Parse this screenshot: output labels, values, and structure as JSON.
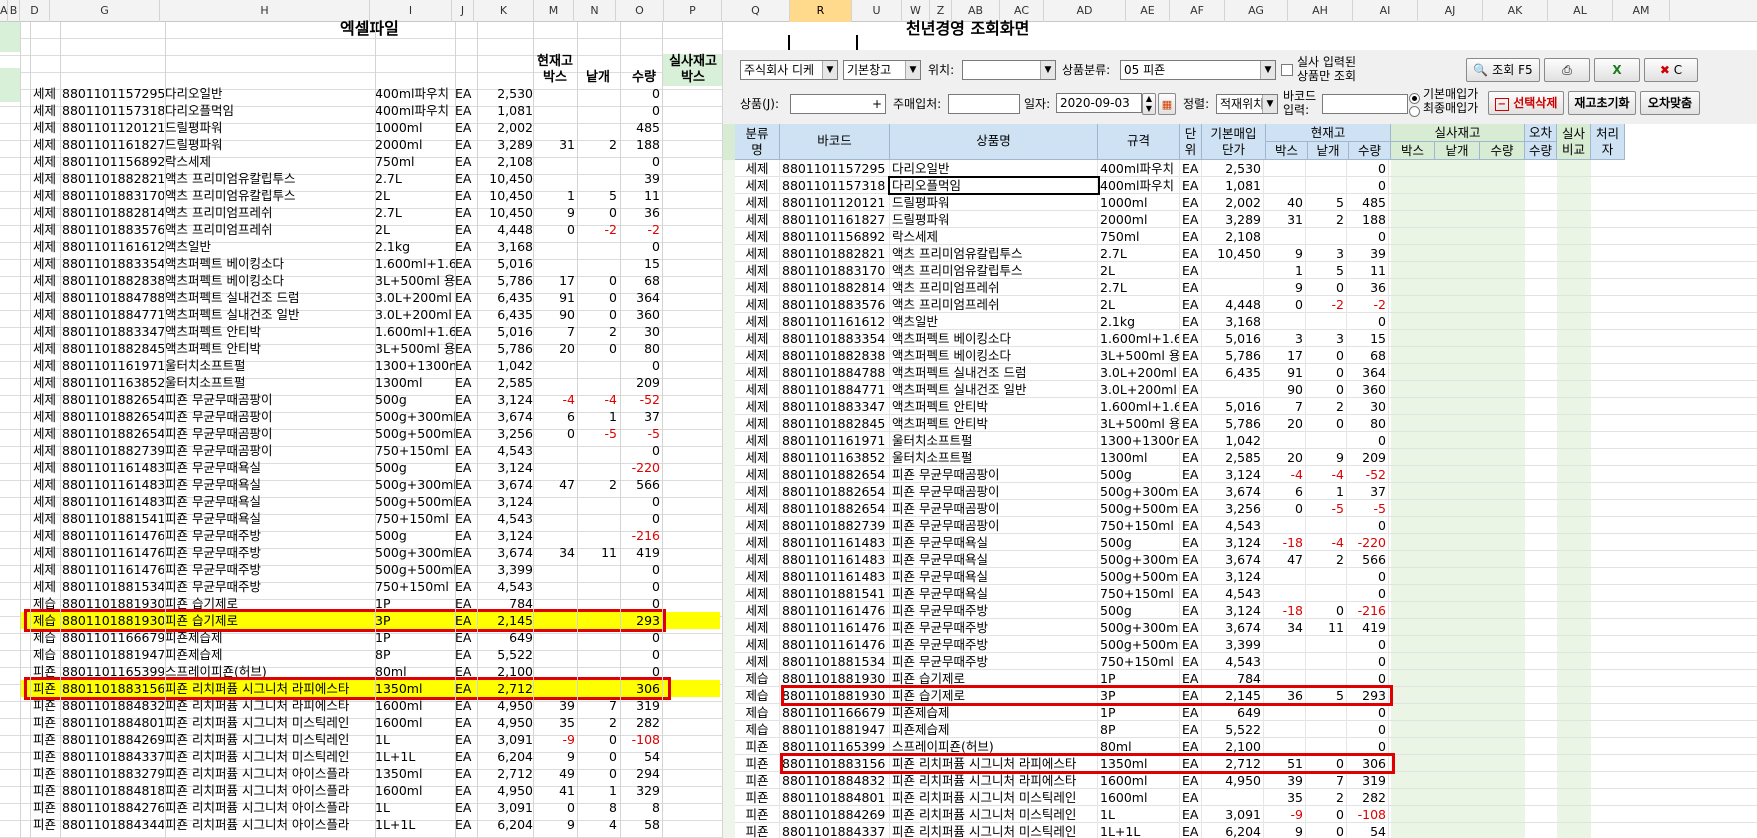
{
  "columns": [
    {
      "label": "A",
      "w": 8
    },
    {
      "label": "B",
      "w": 12
    },
    {
      "label": "D",
      "w": 30
    },
    {
      "label": "G",
      "w": 110
    },
    {
      "label": "H",
      "w": 210
    },
    {
      "label": "I",
      "w": 82
    },
    {
      "label": "J",
      "w": 22
    },
    {
      "label": "K",
      "w": 60
    },
    {
      "label": "M",
      "w": 40
    },
    {
      "label": "N",
      "w": 42
    },
    {
      "label": "O",
      "w": 48
    },
    {
      "label": "P",
      "w": 58
    },
    {
      "label": "Q",
      "w": 68
    },
    {
      "label": "R",
      "w": 62,
      "selected": true
    },
    {
      "label": "U",
      "w": 50
    },
    {
      "label": "W",
      "w": 28
    },
    {
      "label": "Z",
      "w": 22
    },
    {
      "label": "AB",
      "w": 48
    },
    {
      "label": "AC",
      "w": 44
    },
    {
      "label": "AD",
      "w": 82
    },
    {
      "label": "AE",
      "w": 44
    },
    {
      "label": "AF",
      "w": 55
    },
    {
      "label": "AG",
      "w": 63
    },
    {
      "label": "AH",
      "w": 65
    },
    {
      "label": "AI",
      "w": 65
    },
    {
      "label": "AJ",
      "w": 65
    },
    {
      "label": "AK",
      "w": 65
    },
    {
      "label": "AL",
      "w": 65
    },
    {
      "label": "AM",
      "w": 57
    }
  ],
  "left": {
    "title": "엑셀파일",
    "header_current": "현재고",
    "header_box": "박스",
    "header_each": "낱개",
    "header_qty": "수량",
    "header_actual": "실사재고",
    "header_actual_box": "박스",
    "rows": [
      [
        "세제",
        "8801101157295",
        "다리오일반",
        "400ml파우치",
        "EA",
        "2,530",
        "",
        "",
        "0"
      ],
      [
        "세제",
        "8801101157318",
        "다리오플먹임",
        "400ml파우치",
        "EA",
        "1,081",
        "",
        "",
        "0"
      ],
      [
        "세제",
        "8801101120121",
        "드릴평파워",
        "1000ml",
        "EA",
        "2,002",
        "",
        "",
        "485"
      ],
      [
        "세제",
        "8801101161827",
        "드릴평파워",
        "2000ml",
        "EA",
        "3,289",
        "31",
        "2",
        "188"
      ],
      [
        "세제",
        "8801101156892",
        "락스세제",
        "750ml",
        "EA",
        "2,108",
        "",
        "",
        "0"
      ],
      [
        "세제",
        "8801101882821",
        "액츠 프리미엄유칼립투스",
        "2.7L",
        "EA",
        "10,450",
        "",
        "",
        "39"
      ],
      [
        "세제",
        "8801101883170",
        "액츠 프리미엄유칼립투스",
        "2L",
        "EA",
        "10,450",
        "1",
        "5",
        "11"
      ],
      [
        "세제",
        "8801101882814",
        "액츠 프리미엄프레쉬",
        "2.7L",
        "EA",
        "10,450",
        "9",
        "0",
        "36"
      ],
      [
        "세제",
        "8801101883576",
        "액츠 프리미엄프레쉬",
        "2L",
        "EA",
        "4,448",
        "0",
        "-2",
        "-2"
      ],
      [
        "세제",
        "8801101161612",
        "액츠일반",
        "2.1kg",
        "EA",
        "3,168",
        "",
        "",
        "0"
      ],
      [
        "세제",
        "8801101883354",
        "액츠퍼펙트 베이킹소다",
        "1.600ml+1.60",
        "EA",
        "5,016",
        "",
        "",
        "15"
      ],
      [
        "세제",
        "8801101882838",
        "액츠퍼펙트 베이킹소다",
        "3L+500ml 용기",
        "EA",
        "5,786",
        "17",
        "0",
        "68"
      ],
      [
        "세제",
        "8801101884788",
        "액츠퍼펙트 실내건조 드럼",
        "3.0L+200ml",
        "EA",
        "6,435",
        "91",
        "0",
        "364"
      ],
      [
        "세제",
        "8801101884771",
        "액츠퍼펙트 실내건조 일반",
        "3.0L+200ml",
        "EA",
        "6,435",
        "90",
        "0",
        "360"
      ],
      [
        "세제",
        "8801101883347",
        "액츠퍼펙트 안티박",
        "1.600ml+1.60",
        "EA",
        "5,016",
        "7",
        "2",
        "30"
      ],
      [
        "세제",
        "8801101882845",
        "액츠퍼펙트 안티박",
        "3L+500ml 용기",
        "EA",
        "5,786",
        "20",
        "0",
        "80"
      ],
      [
        "세제",
        "8801101161971",
        "울터치소프트펄",
        "1300+1300ml",
        "EA",
        "1,042",
        "",
        "",
        "0"
      ],
      [
        "세제",
        "8801101163852",
        "울터치소프트펄",
        "1300ml",
        "EA",
        "2,585",
        "",
        "",
        "209"
      ],
      [
        "세제",
        "8801101882654",
        "피죤 무균무때곰팡이",
        "500g",
        "EA",
        "3,124",
        "-4",
        "-4",
        "-52"
      ],
      [
        "세제",
        "8801101882654",
        "피죤 무균무때곰팡이",
        "500g+300ml",
        "EA",
        "3,674",
        "6",
        "1",
        "37"
      ],
      [
        "세제",
        "8801101882654",
        "피죤 무균무때곰팡이",
        "500g+500ml",
        "EA",
        "3,256",
        "0",
        "-5",
        "-5"
      ],
      [
        "세제",
        "8801101882739",
        "피죤 무균무때곰팡이",
        "750+150ml",
        "EA",
        "4,543",
        "",
        "",
        "0"
      ],
      [
        "세제",
        "8801101161483",
        "피죤 무균무때욕실",
        "500g",
        "EA",
        "3,124",
        "",
        "",
        "-220"
      ],
      [
        "세제",
        "8801101161483",
        "피죤 무균무때욕실",
        "500g+300ml",
        "EA",
        "3,674",
        "47",
        "2",
        "566"
      ],
      [
        "세제",
        "8801101161483",
        "피죤 무균무때욕실",
        "500g+500ml",
        "EA",
        "3,124",
        "",
        "",
        "0"
      ],
      [
        "세제",
        "8801101881541",
        "피죤 무균무때욕실",
        "750+150ml",
        "EA",
        "4,543",
        "",
        "",
        "0"
      ],
      [
        "세제",
        "8801101161476",
        "피죤 무균무때주방",
        "500g",
        "EA",
        "3,124",
        "",
        "",
        "-216"
      ],
      [
        "세제",
        "8801101161476",
        "피죤 무균무때주방",
        "500g+300ml",
        "EA",
        "3,674",
        "34",
        "11",
        "419"
      ],
      [
        "세제",
        "8801101161476",
        "피죤 무균무때주방",
        "500g+500ml",
        "EA",
        "3,399",
        "",
        "",
        "0"
      ],
      [
        "세제",
        "8801101881534",
        "피죤 무균무때주방",
        "750+150ml",
        "EA",
        "4,543",
        "",
        "",
        "0"
      ],
      [
        "제습",
        "8801101881930",
        "피죤 습기제로",
        "1P",
        "EA",
        "784",
        "",
        "",
        "0"
      ],
      [
        "제습",
        "8801101881930",
        "피죤 습기제로",
        "3P",
        "EA",
        "2,145",
        "",
        "",
        "293"
      ],
      [
        "제습",
        "8801101166679",
        "피죤제습제",
        "1P",
        "EA",
        "649",
        "",
        "",
        "0"
      ],
      [
        "제습",
        "8801101881947",
        "피죤제습제",
        "8P",
        "EA",
        "5,522",
        "",
        "",
        "0"
      ],
      [
        "피죤",
        "8801101165399",
        "스프레이피죤(허브)",
        "80ml",
        "EA",
        "2,100",
        "",
        "",
        "0"
      ],
      [
        "피죤",
        "8801101883156",
        "피죤 리치퍼퓸 시그니처 라피에스타",
        "1350ml",
        "EA",
        "2,712",
        "",
        "",
        "306"
      ],
      [
        "피죤",
        "8801101884832",
        "피죤 리치퍼퓸 시그니처 라피에스타",
        "1600ml",
        "EA",
        "4,950",
        "39",
        "7",
        "319"
      ],
      [
        "피죤",
        "8801101884801",
        "피죤 리치퍼퓸 시그니처 미스틱레인",
        "1600ml",
        "EA",
        "4,950",
        "35",
        "2",
        "282"
      ],
      [
        "피죤",
        "8801101884269",
        "피죤 리치퍼퓸 시그니처 미스틱레인",
        "1L",
        "EA",
        "3,091",
        "-9",
        "0",
        "-108"
      ],
      [
        "피죤",
        "8801101884337",
        "피죤 리치퍼퓸 시그니처 미스틱레인",
        "1L+1L",
        "EA",
        "6,204",
        "9",
        "0",
        "54"
      ],
      [
        "피죤",
        "8801101883279",
        "피죤 리치퍼퓸 시그니처 아이스플라",
        "1350ml",
        "EA",
        "2,712",
        "49",
        "0",
        "294"
      ],
      [
        "피죤",
        "8801101884818",
        "피죤 리치퍼퓸 시그니처 아이스플라",
        "1600ml",
        "EA",
        "4,950",
        "41",
        "1",
        "329"
      ],
      [
        "피죤",
        "8801101884276",
        "피죤 리치퍼퓸 시그니처 아이스플라",
        "1L",
        "EA",
        "3,091",
        "0",
        "8",
        "8"
      ],
      [
        "피죤",
        "8801101884344",
        "피죤 리치퍼퓸 시그니처 아이스플라",
        "1L+1L",
        "EA",
        "6,204",
        "9",
        "4",
        "58"
      ]
    ]
  },
  "right": {
    "title": "천년경영 조회화면",
    "toolbar1": {
      "company": "주식회사 디케",
      "warehouse": "기본창고",
      "location_label": "위치:",
      "location_value": "",
      "category_label": "상품분류:",
      "category_value": "05 피죤",
      "checkbox_label_1": "실사 입력된",
      "checkbox_label_2": "상품만 조회",
      "search_button": "조회 F5"
    },
    "toolbar2": {
      "product_label": "상품(J):",
      "supplier_label": "주매입처:",
      "date_label": "일자:",
      "date_value": "2020-09-03",
      "sort_label": "정렬:",
      "sort_value": "적재위치",
      "barcode_label_1": "바코드",
      "barcode_label_2": "입력:",
      "radio1": "기본매입가",
      "radio2": "최종매입가",
      "delete_button": "선택삭제",
      "reset_button": "재고초기화",
      "fix_button": "오차맞춤"
    },
    "headers": {
      "cat1": "분류",
      "cat2": "명",
      "barcode": "바코드",
      "name": "상품명",
      "spec": "규격",
      "unit1": "단",
      "unit2": "위",
      "price1": "기본매입",
      "price2": "단가",
      "current": "현재고",
      "box": "박스",
      "each": "낱개",
      "qty": "수량",
      "actual": "실사재고",
      "error": "오차",
      "error_qty": "수량",
      "compare1": "실사",
      "compare2": "비교",
      "process1": "처리",
      "process2": "자"
    },
    "rows": [
      [
        "세제",
        "8801101157295",
        "다리오일반",
        "400ml파우치",
        "EA",
        "2,530",
        "",
        "",
        "0"
      ],
      [
        "세제",
        "8801101157318",
        "다리오플먹임",
        "400ml파우치",
        "EA",
        "1,081",
        "",
        "",
        "0"
      ],
      [
        "세제",
        "8801101120121",
        "드릴평파워",
        "1000ml",
        "EA",
        "2,002",
        "40",
        "5",
        "485"
      ],
      [
        "세제",
        "8801101161827",
        "드릴평파워",
        "2000ml",
        "EA",
        "3,289",
        "31",
        "2",
        "188"
      ],
      [
        "세제",
        "8801101156892",
        "락스세제",
        "750ml",
        "EA",
        "2,108",
        "",
        "",
        "0"
      ],
      [
        "세제",
        "8801101882821",
        "액츠 프리미엄유칼립투스",
        "2.7L",
        "EA",
        "10,450",
        "9",
        "3",
        "39"
      ],
      [
        "세제",
        "8801101883170",
        "액츠 프리미엄유칼립투스",
        "2L",
        "EA",
        "",
        "1",
        "5",
        "11"
      ],
      [
        "세제",
        "8801101882814",
        "액츠 프리미엄프레쉬",
        "2.7L",
        "EA",
        "",
        "9",
        "0",
        "36"
      ],
      [
        "세제",
        "8801101883576",
        "액츠 프리미엄프레쉬",
        "2L",
        "EA",
        "4,448",
        "0",
        "-2",
        "-2"
      ],
      [
        "세제",
        "8801101161612",
        "액츠일반",
        "2.1kg",
        "EA",
        "3,168",
        "",
        "",
        "0"
      ],
      [
        "세제",
        "8801101883354",
        "액츠퍼펙트 베이킹소다",
        "1.600ml+1.60",
        "EA",
        "5,016",
        "3",
        "3",
        "15"
      ],
      [
        "세제",
        "8801101882838",
        "액츠퍼펙트 베이킹소다",
        "3L+500ml 용기",
        "EA",
        "5,786",
        "17",
        "0",
        "68"
      ],
      [
        "세제",
        "8801101884788",
        "액츠퍼펙트 실내건조 드럼",
        "3.0L+200ml",
        "EA",
        "6,435",
        "91",
        "0",
        "364"
      ],
      [
        "세제",
        "8801101884771",
        "액츠퍼펙트 실내건조 일반",
        "3.0L+200ml",
        "EA",
        "",
        "90",
        "0",
        "360"
      ],
      [
        "세제",
        "8801101883347",
        "액츠퍼펙트 안티박",
        "1.600ml+1.60",
        "EA",
        "5,016",
        "7",
        "2",
        "30"
      ],
      [
        "세제",
        "8801101882845",
        "액츠퍼펙트 안티박",
        "3L+500ml 용기",
        "EA",
        "5,786",
        "20",
        "0",
        "80"
      ],
      [
        "세제",
        "8801101161971",
        "울터치소프트펄",
        "1300+1300ml",
        "EA",
        "1,042",
        "",
        "",
        "0"
      ],
      [
        "세제",
        "8801101163852",
        "울터치소프트펄",
        "1300ml",
        "EA",
        "2,585",
        "20",
        "9",
        "209"
      ],
      [
        "세제",
        "8801101882654",
        "피죤 무균무때곰팡이",
        "500g",
        "EA",
        "3,124",
        "-4",
        "-4",
        "-52"
      ],
      [
        "세제",
        "8801101882654",
        "피죤 무균무때곰팡이",
        "500g+300ml",
        "EA",
        "3,674",
        "6",
        "1",
        "37"
      ],
      [
        "세제",
        "8801101882654",
        "피죤 무균무때곰팡이",
        "500g+500ml",
        "EA",
        "3,256",
        "0",
        "-5",
        "-5"
      ],
      [
        "세제",
        "8801101882739",
        "피죤 무균무때곰팡이",
        "750+150ml",
        "EA",
        "4,543",
        "",
        "",
        "0"
      ],
      [
        "세제",
        "8801101161483",
        "피죤 무균무때욕실",
        "500g",
        "EA",
        "3,124",
        "-18",
        "-4",
        "-220"
      ],
      [
        "세제",
        "8801101161483",
        "피죤 무균무때욕실",
        "500g+300ml",
        "EA",
        "3,674",
        "47",
        "2",
        "566"
      ],
      [
        "세제",
        "8801101161483",
        "피죤 무균무때욕실",
        "500g+500ml",
        "EA",
        "3,124",
        "",
        "",
        "0"
      ],
      [
        "세제",
        "8801101881541",
        "피죤 무균무때욕실",
        "750+150ml",
        "EA",
        "4,543",
        "",
        "",
        "0"
      ],
      [
        "세제",
        "8801101161476",
        "피죤 무균무때주방",
        "500g",
        "EA",
        "3,124",
        "-18",
        "0",
        "-216"
      ],
      [
        "세제",
        "8801101161476",
        "피죤 무균무때주방",
        "500g+300ml",
        "EA",
        "3,674",
        "34",
        "11",
        "419"
      ],
      [
        "세제",
        "8801101161476",
        "피죤 무균무때주방",
        "500g+500ml",
        "EA",
        "3,399",
        "",
        "",
        "0"
      ],
      [
        "세제",
        "8801101881534",
        "피죤 무균무때주방",
        "750+150ml",
        "EA",
        "4,543",
        "",
        "",
        "0"
      ],
      [
        "제습",
        "8801101881930",
        "피죤 습기제로",
        "1P",
        "EA",
        "784",
        "",
        "",
        "0"
      ],
      [
        "제습",
        "8801101881930",
        "피죤 습기제로",
        "3P",
        "EA",
        "2,145",
        "36",
        "5",
        "293"
      ],
      [
        "제습",
        "8801101166679",
        "피죤제습제",
        "1P",
        "EA",
        "649",
        "",
        "",
        "0"
      ],
      [
        "제습",
        "8801101881947",
        "피죤제습제",
        "8P",
        "EA",
        "5,522",
        "",
        "",
        "0"
      ],
      [
        "피죤",
        "8801101165399",
        "스프레이피죤(허브)",
        "80ml",
        "EA",
        "2,100",
        "",
        "",
        "0"
      ],
      [
        "피죤",
        "8801101883156",
        "피죤 리치퍼퓸 시그니처 라피에스타",
        "1350ml",
        "EA",
        "2,712",
        "51",
        "0",
        "306"
      ],
      [
        "피죤",
        "8801101884832",
        "피죤 리치퍼퓸 시그니처 라피에스타",
        "1600ml",
        "EA",
        "4,950",
        "39",
        "7",
        "319"
      ],
      [
        "피죤",
        "8801101884801",
        "피죤 리치퍼퓸 시그니처 미스틱레인",
        "1600ml",
        "EA",
        "",
        "35",
        "2",
        "282"
      ],
      [
        "피죤",
        "8801101884269",
        "피죤 리치퍼퓸 시그니처 미스틱레인",
        "1L",
        "EA",
        "3,091",
        "-9",
        "0",
        "-108"
      ],
      [
        "피죤",
        "8801101884337",
        "피죤 리치퍼퓸 시그니처 미스틱레인",
        "1L+1L",
        "EA",
        "6,204",
        "9",
        "0",
        "54"
      ]
    ]
  }
}
